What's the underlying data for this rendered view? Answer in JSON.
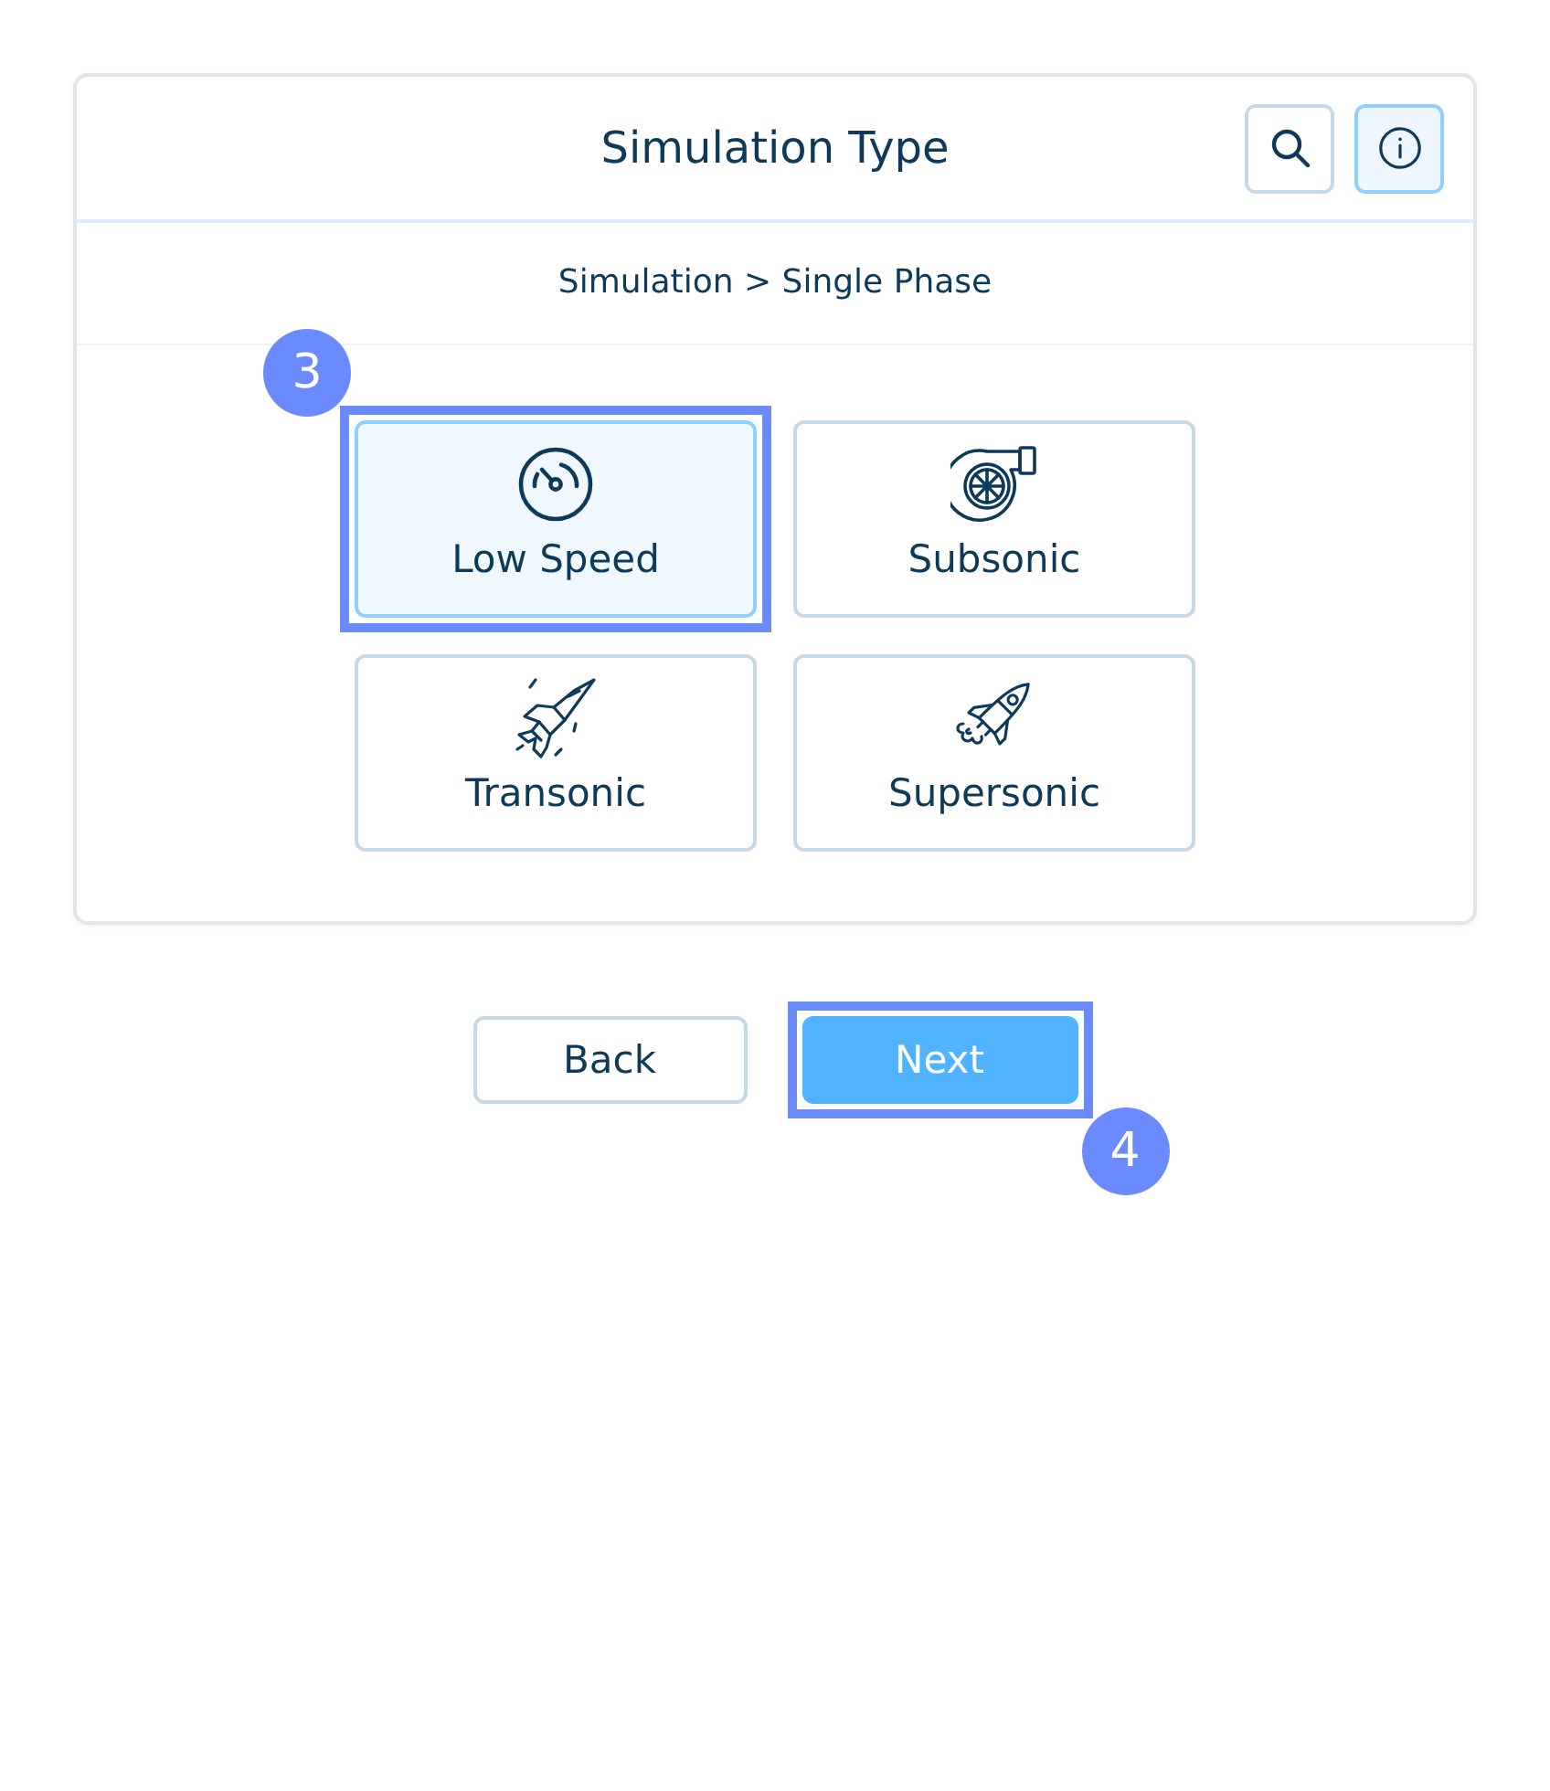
{
  "header": {
    "title": "Simulation Type",
    "buttons": [
      {
        "selected": false
      },
      {
        "selected": true
      }
    ]
  },
  "breadcrumb": "Simulation > Single Phase",
  "options": [
    {
      "label": "Low Speed",
      "selected": true,
      "callout": {
        "number": "3",
        "badge_trailing": false
      }
    },
    {
      "label": "Subsonic",
      "selected": false
    },
    {
      "label": "Transonic",
      "selected": false
    },
    {
      "label": "Supersonic",
      "selected": false
    }
  ],
  "actions": [
    {
      "label": "Back",
      "kind": "secondary"
    },
    {
      "label": "Next",
      "kind": "primary",
      "callout": {
        "number": "4",
        "badge_trailing": true
      }
    }
  ]
}
